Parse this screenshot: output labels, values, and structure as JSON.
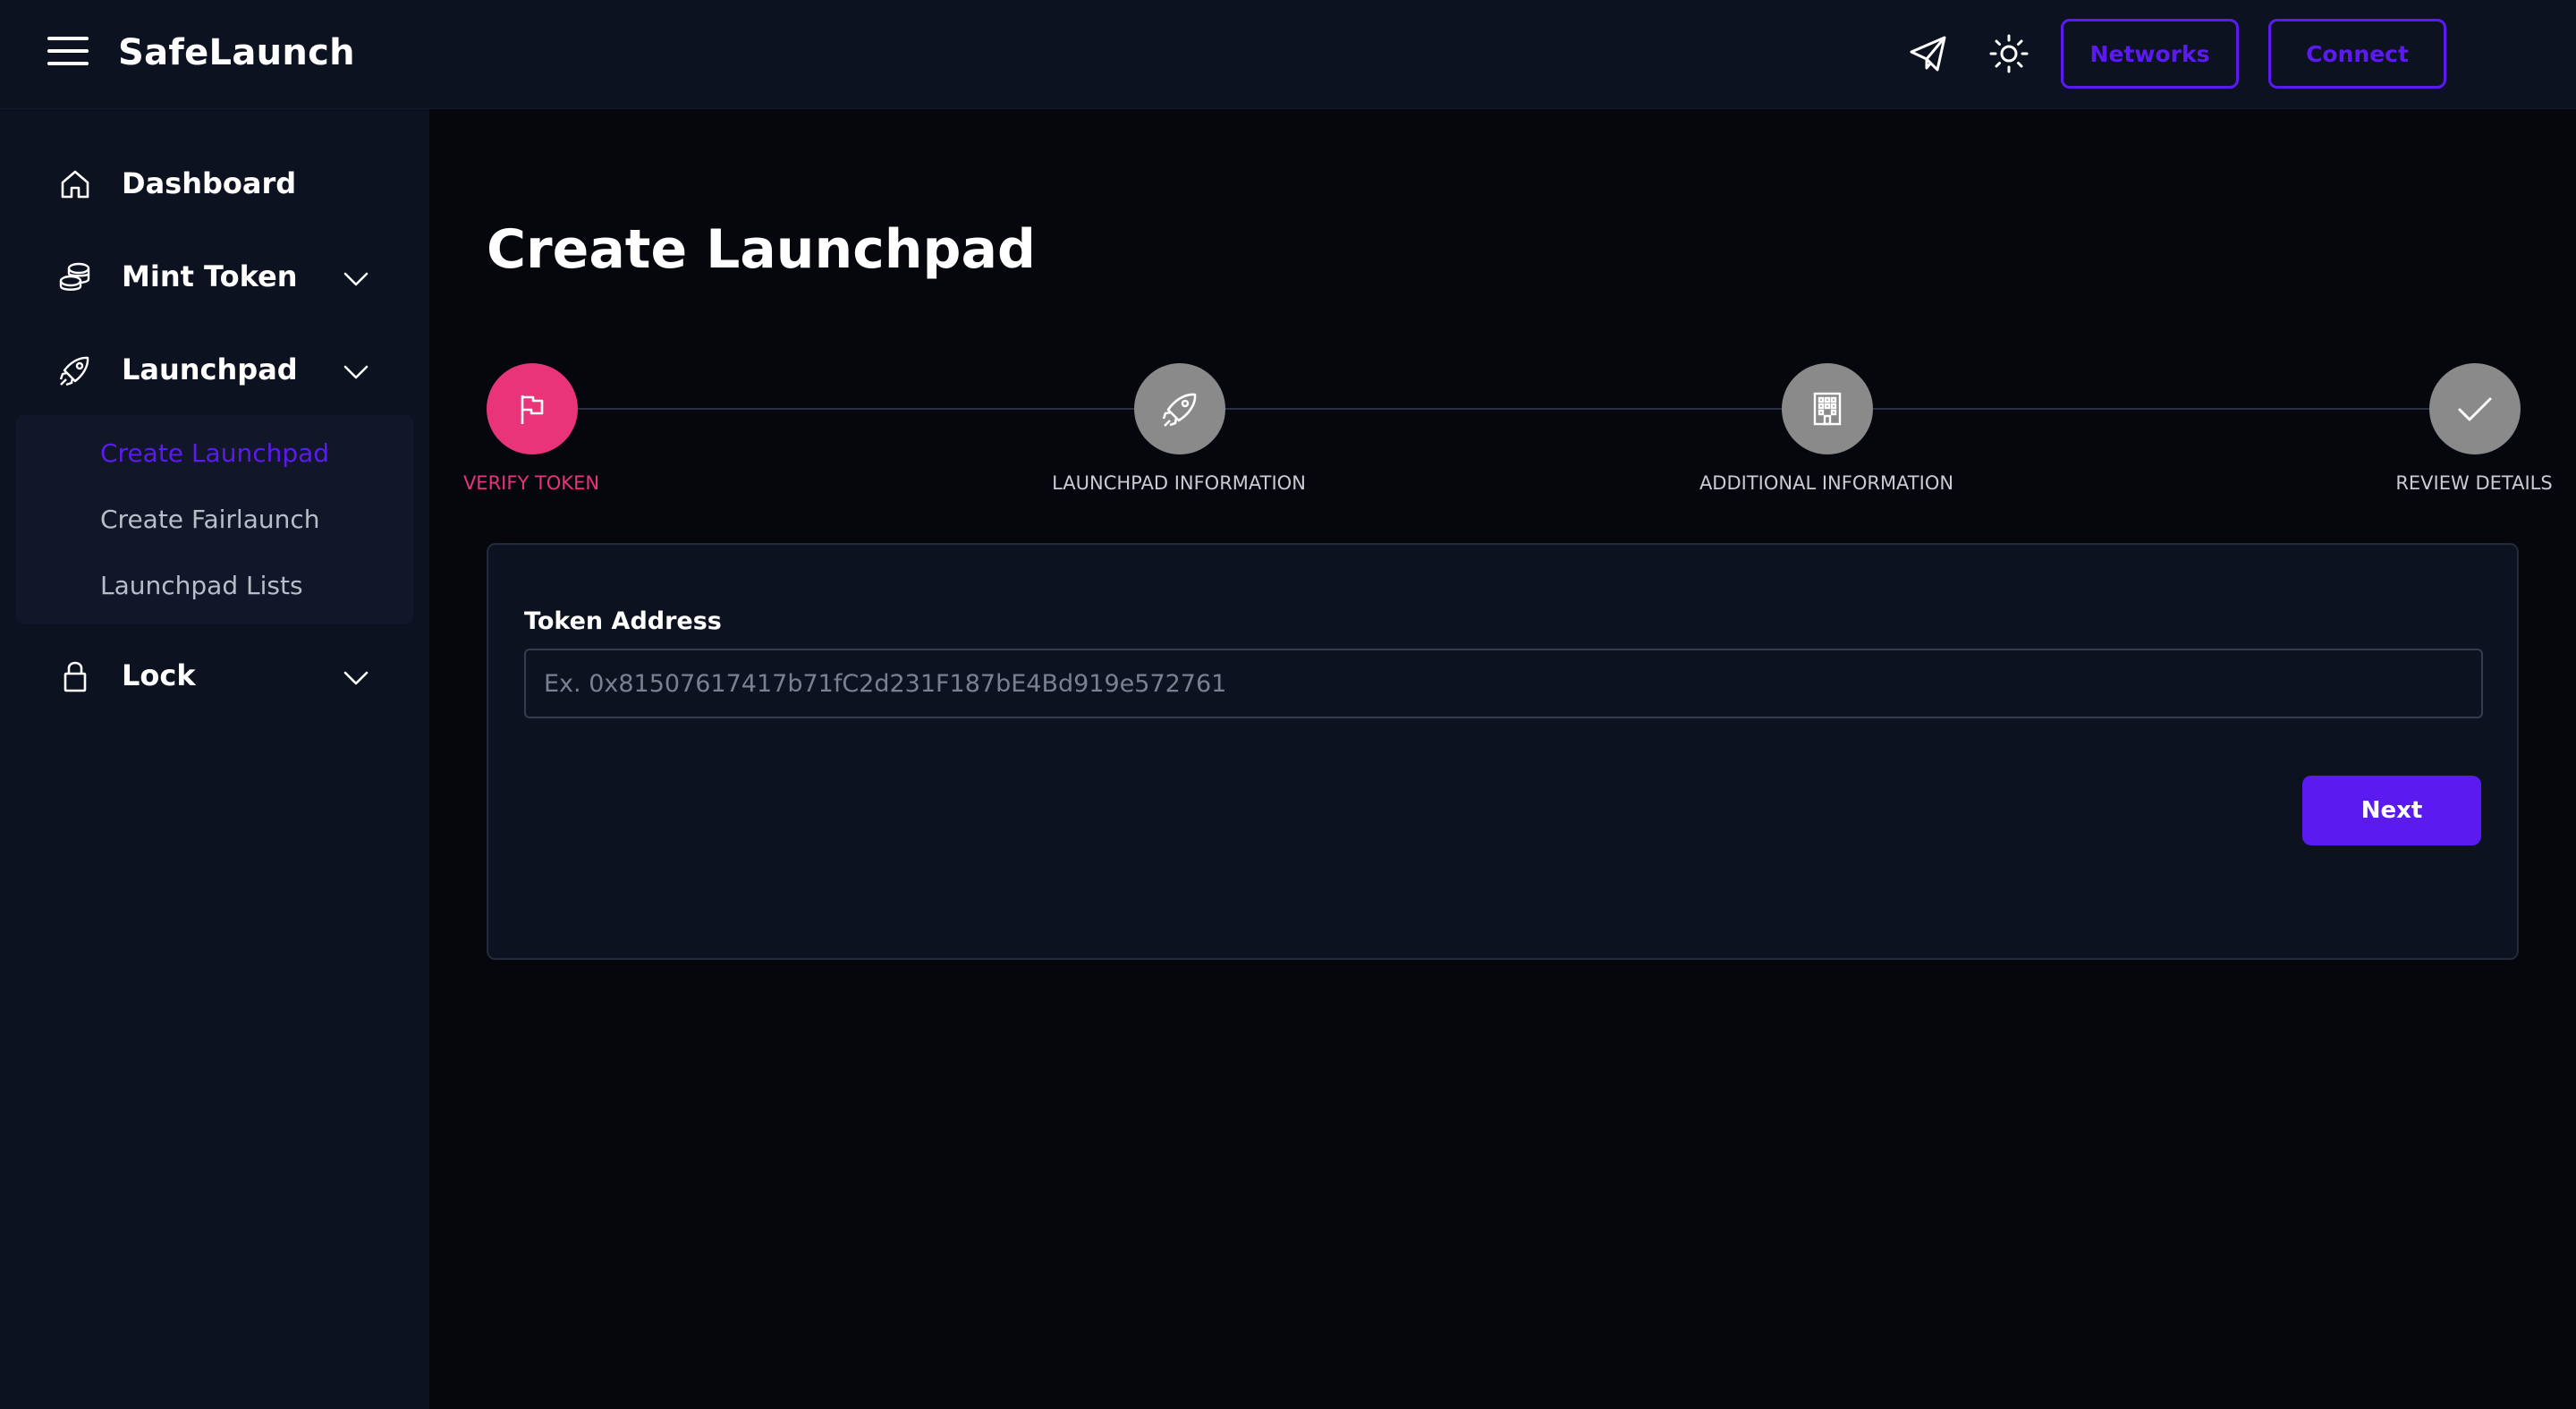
{
  "header": {
    "brand": "SafeLaunch",
    "networks_label": "Networks",
    "connect_label": "Connect"
  },
  "sidebar": {
    "items": [
      {
        "label": "Dashboard",
        "icon": "home-icon"
      },
      {
        "label": "Mint Token",
        "icon": "coins-icon"
      },
      {
        "label": "Launchpad",
        "icon": "rocket-icon"
      },
      {
        "label": "Lock",
        "icon": "lock-icon"
      }
    ],
    "launchpad_sub": [
      {
        "label": "Create Launchpad",
        "active": true
      },
      {
        "label": "Create Fairlaunch",
        "active": false
      },
      {
        "label": "Launchpad Lists",
        "active": false
      }
    ]
  },
  "main": {
    "title": "Create Launchpad",
    "steps": [
      {
        "label": "VERIFY TOKEN",
        "icon": "flag-icon",
        "active": true
      },
      {
        "label": "LAUNCHPAD INFORMATION",
        "icon": "rocket-icon",
        "active": false
      },
      {
        "label": "ADDITIONAL INFORMATION",
        "icon": "building-icon",
        "active": false
      },
      {
        "label": "REVIEW DETAILS",
        "icon": "check-icon",
        "active": false
      }
    ],
    "form": {
      "token_label": "Token Address",
      "token_placeholder": "Ex. 0x81507617417b71fC2d231F187bE4Bd919e572761",
      "token_value": "",
      "next_label": "Next"
    }
  },
  "colors": {
    "accent": "#5b1bf0",
    "step_active": "#e9347a",
    "step_inactive": "#8a8a8a",
    "panel": "#0d1220",
    "background": "#05070d"
  }
}
